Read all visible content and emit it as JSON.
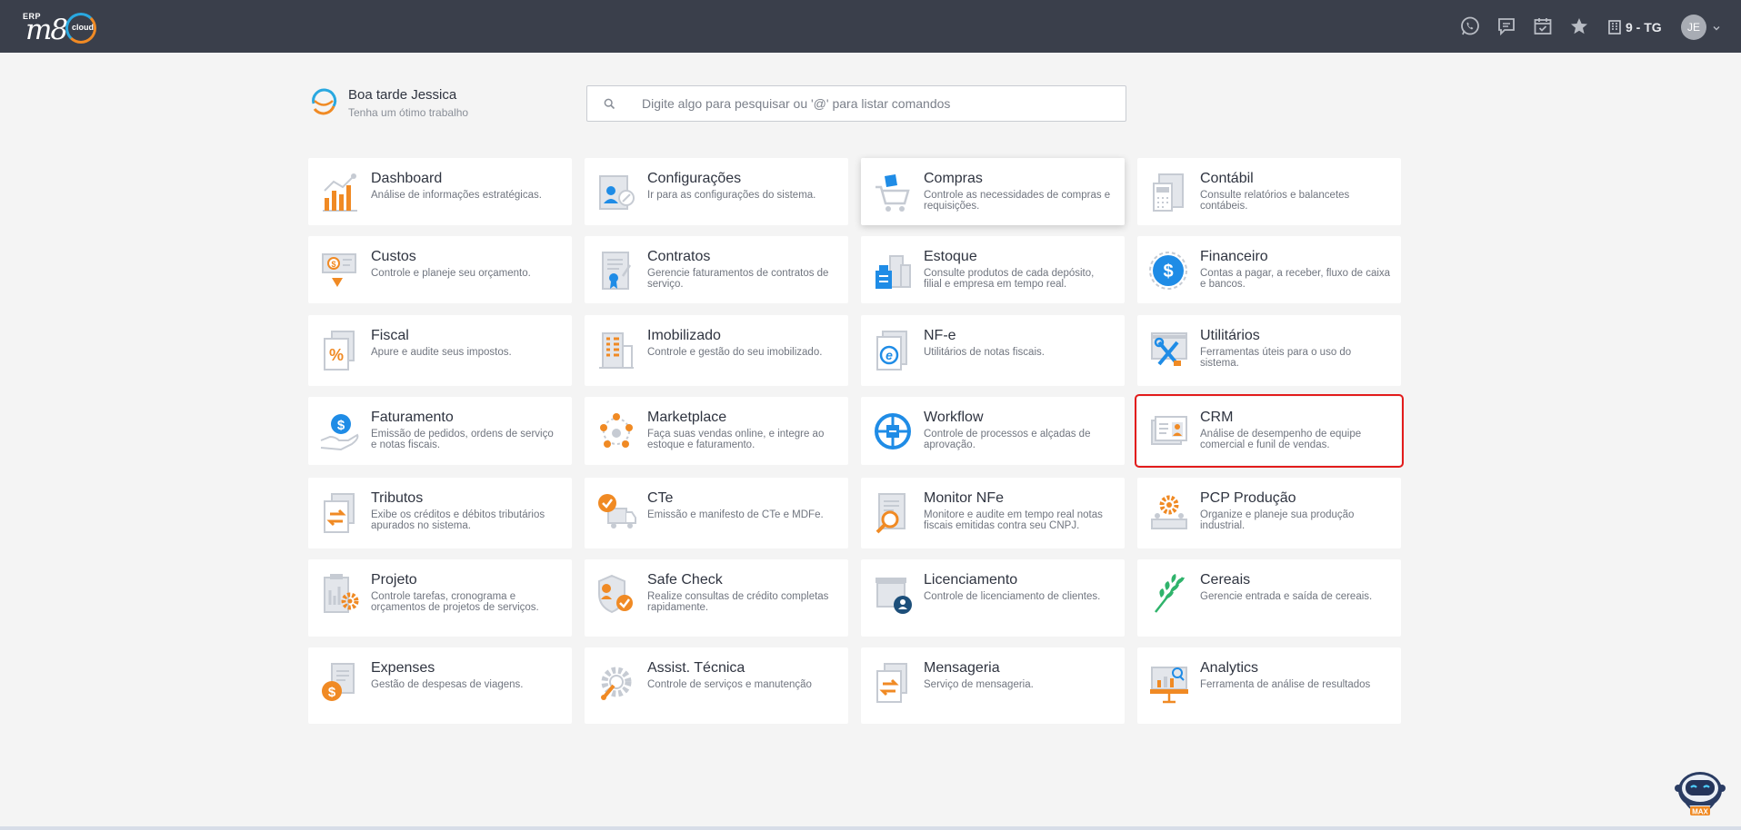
{
  "app": {
    "logo_erp": "ERP",
    "logo_m8": "m8",
    "logo_cloud": "cloud",
    "org_label": "9 - TG",
    "user_initials": "JE",
    "colors": {
      "topbar": "#3a3f4b",
      "orange": "#f08a24",
      "blue": "#1f8ce6",
      "highlight": "#e21b1b"
    },
    "top_icons": [
      "whatsapp-icon",
      "chat-icon",
      "calendar-icon",
      "star-icon",
      "building-icon"
    ]
  },
  "greeting": {
    "title": "Boa tarde Jessica",
    "subtitle": "Tenha um ótimo trabalho"
  },
  "search": {
    "placeholder": "Digite algo para pesquisar ou '@' para listar comandos"
  },
  "modules": [
    {
      "title": "Dashboard",
      "desc": "Análise de informações estratégicas.",
      "icon": "bar-chart-icon"
    },
    {
      "title": "Configurações",
      "desc": "Ir para as configurações do sistema.",
      "icon": "settings-profile-icon"
    },
    {
      "title": "Compras",
      "desc": "Controle as necessidades de compras e requisições.",
      "icon": "shopping-cart-icon"
    },
    {
      "title": "Contábil",
      "desc": "Consulte relatórios e balancetes contábeis.",
      "icon": "calculator-document-icon"
    },
    {
      "title": "Custos",
      "desc": "Controle e planeje seu orçamento.",
      "icon": "money-down-icon"
    },
    {
      "title": "Contratos",
      "desc": "Gerencie faturamentos de contratos de serviço.",
      "icon": "contract-icon"
    },
    {
      "title": "Estoque",
      "desc": "Consulte produtos de cada depósito, filial e empresa em tempo real.",
      "icon": "warehouse-icon"
    },
    {
      "title": "Financeiro",
      "desc": "Contas a pagar, a receber, fluxo de caixa e bancos.",
      "icon": "dollar-coin-icon"
    },
    {
      "title": "Fiscal",
      "desc": "Apure e audite seus impostos.",
      "icon": "percent-document-icon"
    },
    {
      "title": "Imobilizado",
      "desc": "Controle e gestão do seu imobilizado.",
      "icon": "building-asset-icon"
    },
    {
      "title": "NF-e",
      "desc": "Utilitários de notas fiscais.",
      "icon": "nfe-document-icon"
    },
    {
      "title": "Utilitários",
      "desc": "Ferramentas úteis para o uso do sistema.",
      "icon": "tools-icon"
    },
    {
      "title": "Faturamento",
      "desc": "Emissão de pedidos, ordens de serviço e notas fiscais.",
      "icon": "hand-dollar-icon"
    },
    {
      "title": "Marketplace",
      "desc": "Faça suas vendas online, e integre ao estoque e faturamento.",
      "icon": "network-users-icon"
    },
    {
      "title": "Workflow",
      "desc": "Controle de processos e alçadas de aprovação.",
      "icon": "workflow-icon"
    },
    {
      "title": "CRM",
      "desc": "Análise de desempenho de equipe comercial e funil de vendas.",
      "icon": "crm-card-icon"
    },
    {
      "title": "Tributos",
      "desc": "Exibe os créditos e débitos tributários apurados no sistema.",
      "icon": "transfer-document-icon"
    },
    {
      "title": "CTe",
      "desc": "Emissão e manifesto de CTe e MDFe.",
      "icon": "truck-check-icon"
    },
    {
      "title": "Monitor NFe",
      "desc": "Monitore e audite em tempo real notas fiscais emitidas contra seu CNPJ.",
      "icon": "magnifier-document-icon"
    },
    {
      "title": "PCP Produção",
      "desc": "Organize e planeje sua produção industrial.",
      "icon": "production-gear-icon"
    },
    {
      "title": "Projeto",
      "desc": "Controle tarefas, cronograma e orçamentos de projetos de serviços.",
      "icon": "project-gear-icon"
    },
    {
      "title": "Safe Check",
      "desc": "Realize consultas de crédito completas rapidamente.",
      "icon": "shield-check-icon"
    },
    {
      "title": "Licenciamento",
      "desc": "Controle de licenciamento de clientes.",
      "icon": "license-user-icon"
    },
    {
      "title": "Cereais",
      "desc": "Gerencie entrada e saída de cereais.",
      "icon": "wheat-icon"
    },
    {
      "title": "Expenses",
      "desc": "Gestão de despesas de viagens.",
      "icon": "expense-coin-icon"
    },
    {
      "title": "Assist. Técnica",
      "desc": "Controle de serviços e manutenção",
      "icon": "service-gear-icon"
    },
    {
      "title": "Mensageria",
      "desc": "Serviço de mensageria.",
      "icon": "message-transfer-icon"
    },
    {
      "title": "Analytics",
      "desc": "Ferramenta de análise de resultados",
      "icon": "analytics-board-icon"
    }
  ],
  "assistant": {
    "label": "MAX"
  }
}
